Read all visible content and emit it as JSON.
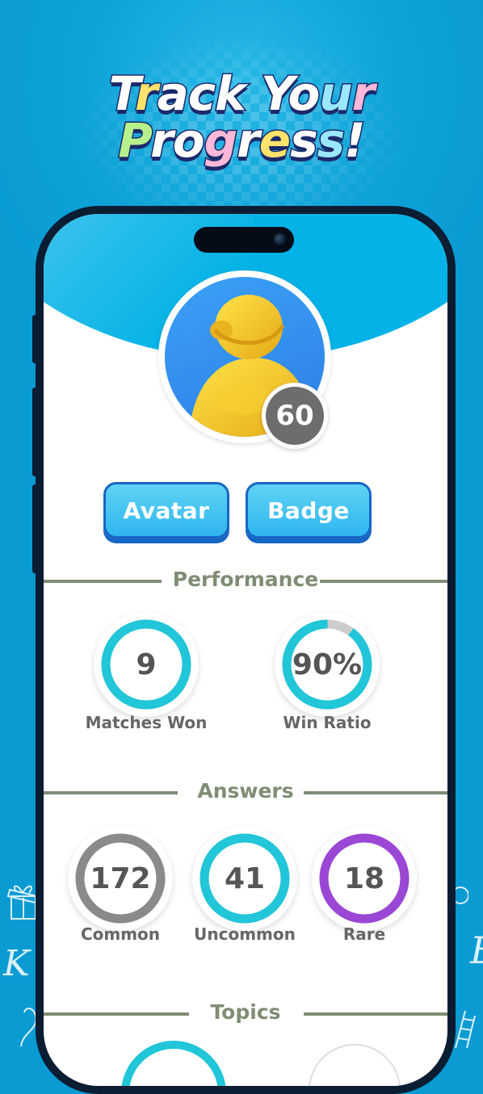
{
  "headline": {
    "line1": [
      {
        "text": "T",
        "color": "#ffffff"
      },
      {
        "text": "r",
        "color": "#ffe36a"
      },
      {
        "text": "a",
        "color": "#ffffff"
      },
      {
        "text": "c",
        "color": "#ffffff"
      },
      {
        "text": "k ",
        "color": "#ffffff"
      },
      {
        "text": "Y",
        "color": "#ffffff"
      },
      {
        "text": "o",
        "color": "#ffffff"
      },
      {
        "text": "u",
        "color": "#9ae8ff"
      },
      {
        "text": "r",
        "color": "#ffb8d8"
      }
    ],
    "line2": [
      {
        "text": "P",
        "color": "#b6f08a"
      },
      {
        "text": "r",
        "color": "#ffffff"
      },
      {
        "text": "o",
        "color": "#ffffff"
      },
      {
        "text": "g",
        "color": "#ffb8d8"
      },
      {
        "text": "r",
        "color": "#ffffff"
      },
      {
        "text": "e",
        "color": "#ffe36a"
      },
      {
        "text": "s",
        "color": "#ffffff"
      },
      {
        "text": "s",
        "color": "#9ae8ff"
      },
      {
        "text": "!",
        "color": "#ffffff"
      }
    ]
  },
  "profile": {
    "avatar_icon": "person-avatar-icon",
    "level": "60"
  },
  "buttons": {
    "avatar_label": "Avatar",
    "badge_label": "Badge"
  },
  "sections": {
    "performance": "Performance",
    "answers": "Answers",
    "topics": "Topics"
  },
  "performance": [
    {
      "value": "9",
      "label": "Matches Won",
      "progress": 1.0,
      "color": "#21c6d8"
    },
    {
      "value": "90%",
      "label": "Win Ratio",
      "progress": 0.9,
      "color": "#21c6d8"
    }
  ],
  "answers": [
    {
      "value": "172",
      "label": "Common",
      "progress": 1.0,
      "color": "#8a8a8a"
    },
    {
      "value": "41",
      "label": "Uncommon",
      "progress": 1.0,
      "color": "#21c6d8"
    },
    {
      "value": "18",
      "label": "Rare",
      "progress": 1.0,
      "color": "#9b47d6"
    }
  ],
  "colors": {
    "background": "#0a9bd3",
    "screen_header": "#03b2e6",
    "section_rule": "#7f8d74",
    "button": "#2fb6ef",
    "ring_track": "#cccccc"
  }
}
